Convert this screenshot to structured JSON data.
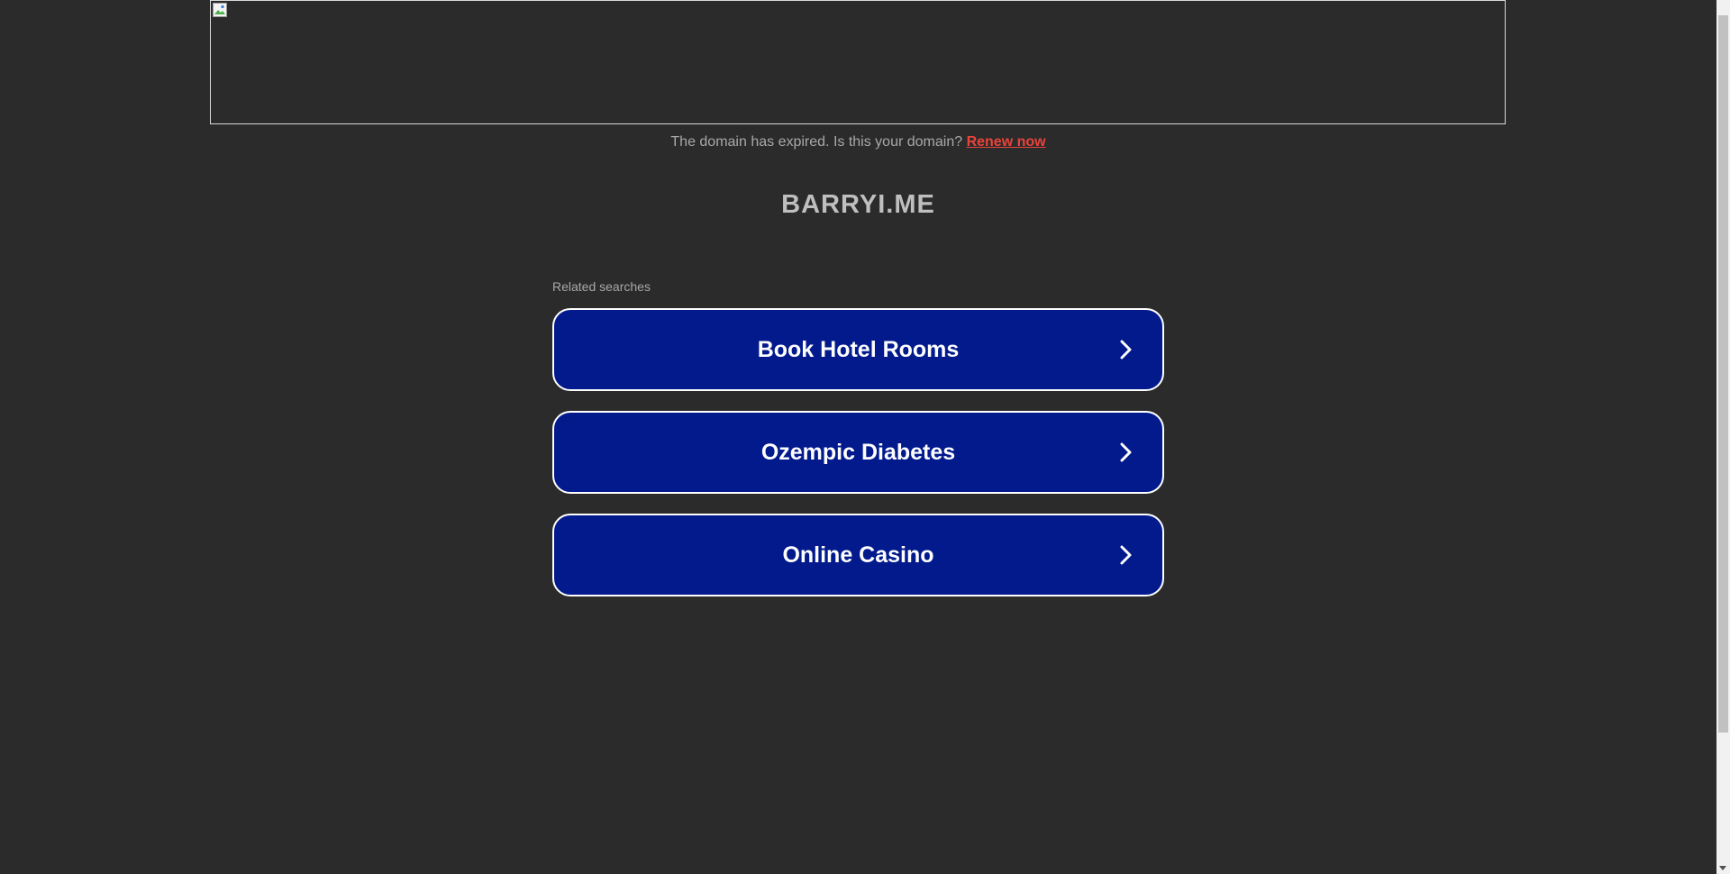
{
  "expired_notice": {
    "text": "The domain has expired. Is this your domain?",
    "link_label": "Renew now"
  },
  "domain_name": "BARRYI.ME",
  "related": {
    "heading": "Related searches",
    "items": [
      {
        "label": "Book Hotel Rooms"
      },
      {
        "label": "Ozempic Diabetes"
      },
      {
        "label": "Online Casino"
      }
    ]
  },
  "colors": {
    "background": "#2b2b2b",
    "button": "#021a8c",
    "link": "#e8443a"
  },
  "icons": {
    "button_chevron": "chevron-right-icon",
    "banner": "broken-image-icon"
  }
}
